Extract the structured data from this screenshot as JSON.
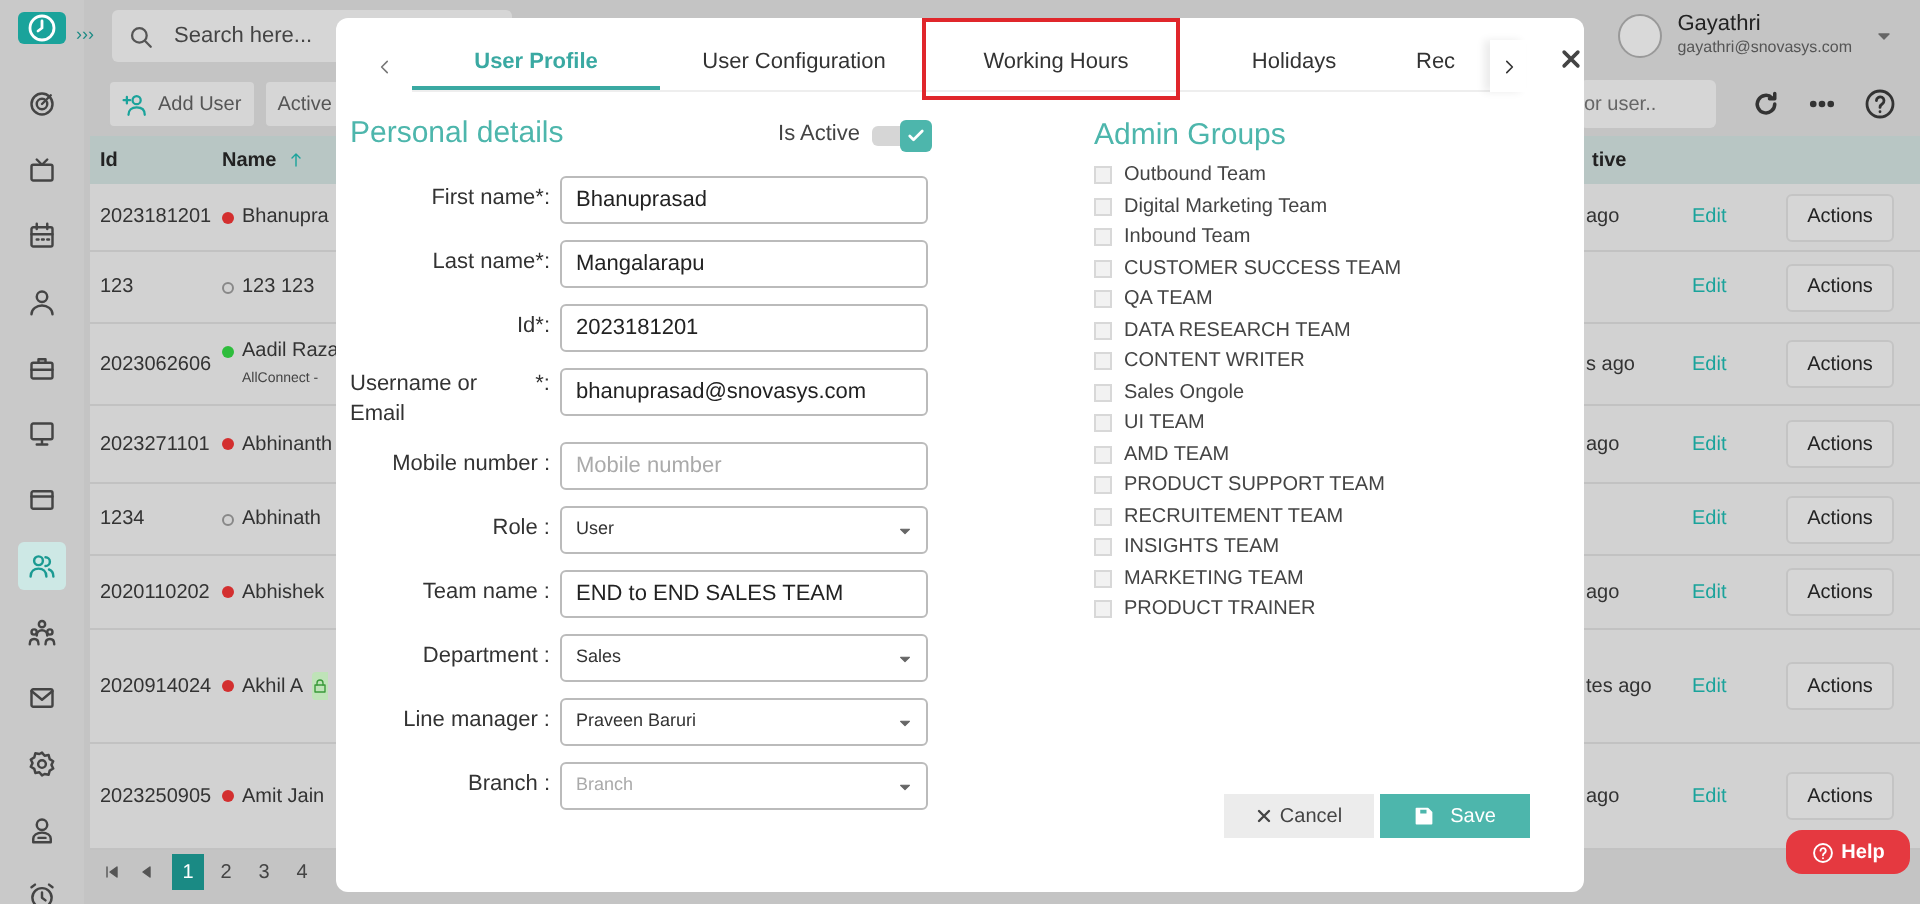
{
  "topbar": {
    "expand_label": "›››",
    "search_placeholder": "Search here...",
    "user": {
      "name": "Gayathri",
      "email": "gayathri@snovasys.com"
    }
  },
  "sidebar": {
    "items": [
      {
        "selected": false
      },
      {
        "selected": false
      },
      {
        "selected": false
      },
      {
        "selected": false
      },
      {
        "selected": false
      },
      {
        "selected": false
      },
      {
        "selected": false
      },
      {
        "selected": true
      },
      {
        "selected": false
      },
      {
        "selected": false
      },
      {
        "selected": false
      },
      {
        "selected": false
      },
      {
        "selected": false
      }
    ]
  },
  "toolbar": {
    "buttons": [
      "Add User",
      "Active"
    ],
    "search_placeholder": "or user.."
  },
  "table": {
    "columns": [
      "Id",
      "Name",
      "tive"
    ],
    "rows": [
      {
        "id": "2023181201",
        "name": "Bhanupra",
        "color": "#d32f2f",
        "last_active": "ago",
        "edit": "Edit",
        "actions": "Actions"
      },
      {
        "id": "123",
        "name": "123 123",
        "edit": "Edit",
        "actions": "Actions"
      },
      {
        "id": "2023062606",
        "name": "Aadil Raza",
        "subtitle": "AllConnect -",
        "color": "#2ebd3c",
        "last_active": "s ago",
        "edit": "Edit",
        "actions": "Actions"
      },
      {
        "id": "2023271101",
        "name": "Abhinanth",
        "color": "#d32f2f",
        "last_active": "ago",
        "edit": "Edit",
        "actions": "Actions"
      },
      {
        "id": "1234",
        "name": "Abhinath",
        "edit": "Edit",
        "actions": "Actions"
      },
      {
        "id": "2020110202",
        "name": "Abhishek",
        "color": "#d32f2f",
        "last_active": "ago",
        "edit": "Edit",
        "actions": "Actions"
      },
      {
        "id": "2020914024",
        "name": "Akhil A",
        "color": "#d32f2f",
        "locked": true,
        "last_active": "tes ago",
        "edit": "Edit",
        "actions": "Actions"
      },
      {
        "id": "2023250905",
        "name": "Amit Jain",
        "color": "#d32f2f",
        "last_active": "ago",
        "edit": "Edit",
        "actions": "Actions"
      }
    ]
  },
  "pagination": {
    "pages": [
      {
        "label": "1",
        "selected": true
      },
      {
        "label": "2",
        "selected": false
      },
      {
        "label": "3",
        "selected": false
      },
      {
        "label": "4",
        "selected": false
      }
    ]
  },
  "dialog": {
    "tabs": [
      {
        "label": "User Profile",
        "selected": true,
        "highlighted": false
      },
      {
        "label": "User Configuration",
        "selected": false,
        "highlighted": false
      },
      {
        "label": "Working Hours",
        "selected": false,
        "highlighted": true
      },
      {
        "label": "Holidays",
        "selected": false,
        "highlighted": false
      },
      {
        "label": "Rec",
        "selected": false,
        "highlighted": false
      }
    ],
    "personal_details": {
      "title": "Personal details",
      "is_active": {
        "label": "Is Active",
        "on": true
      },
      "fields": [
        {
          "kind": "text",
          "label": "First name*:",
          "value": "Bhanuprasad"
        },
        {
          "kind": "text",
          "label": "Last name*:",
          "value": "Mangalarapu"
        },
        {
          "kind": "text",
          "label": "Id*:",
          "value": "2023181201"
        },
        {
          "kind": "text",
          "label": "Username or Email",
          "suffix": "*:",
          "value": "bhanuprasad@snovasys.com"
        },
        {
          "kind": "text",
          "label": "Mobile number :",
          "placeholder": "Mobile number"
        },
        {
          "kind": "select",
          "label": "Role :",
          "value": "User"
        },
        {
          "kind": "text",
          "label": "Team name :",
          "value": "END to END SALES TEAM"
        },
        {
          "kind": "select",
          "label": "Department :",
          "value": "Sales"
        },
        {
          "kind": "select",
          "label": "Line manager :",
          "value": "Praveen Baruri"
        },
        {
          "kind": "select",
          "label": "Branch :",
          "placeholder": "Branch"
        }
      ]
    },
    "admin_groups": {
      "title": "Admin Groups",
      "items": [
        {
          "label": "Outbound Team",
          "checked": false
        },
        {
          "label": "Digital Marketing Team",
          "checked": false
        },
        {
          "label": "Inbound Team",
          "checked": false
        },
        {
          "label": "CUSTOMER SUCCESS TEAM",
          "checked": false
        },
        {
          "label": "QA TEAM",
          "checked": false
        },
        {
          "label": "DATA RESEARCH TEAM",
          "checked": false
        },
        {
          "label": "CONTENT WRITER",
          "checked": false
        },
        {
          "label": "Sales Ongole",
          "checked": false
        },
        {
          "label": "UI TEAM",
          "checked": false
        },
        {
          "label": "AMD TEAM",
          "checked": false
        },
        {
          "label": "PRODUCT SUPPORT TEAM",
          "checked": false
        },
        {
          "label": "RECRUITEMENT TEAM",
          "checked": false
        },
        {
          "label": "INSIGHTS TEAM",
          "checked": false
        },
        {
          "label": "MARKETING TEAM",
          "checked": false
        },
        {
          "label": "PRODUCT TRAINER",
          "checked": false
        }
      ]
    },
    "buttons": {
      "cancel": "Cancel",
      "save": "Save"
    }
  },
  "help_button": {
    "label": "Help"
  }
}
